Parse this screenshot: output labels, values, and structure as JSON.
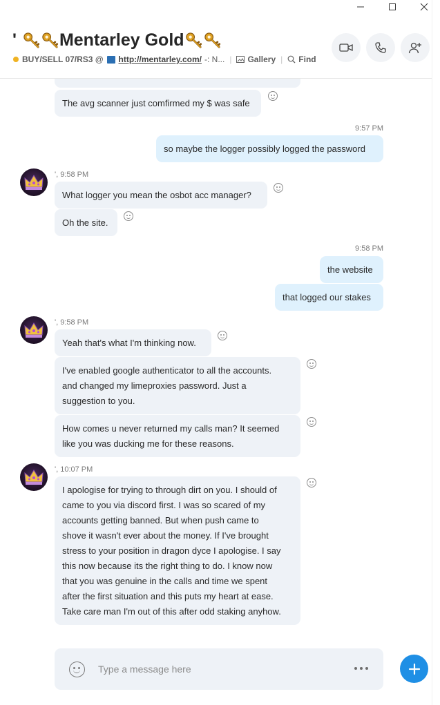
{
  "window": {
    "title_icons": [
      "minimize-icon",
      "maximize-icon",
      "close-icon"
    ]
  },
  "header": {
    "title_prefix": "'",
    "title_text": "Mentarley Gold",
    "topic_label": "BUY/SELL 07/RS3 @",
    "topic_link": "http://mentarley.com/",
    "topic_suffix": "-: N...",
    "gallery_label": "Gallery",
    "find_label": "Find"
  },
  "messages": {
    "m0_text": "The avg scanner just comfirmed my $ was safe",
    "t1": "9:57 PM",
    "m1_text": "so maybe the logger possibly logged the password",
    "t2": "', 9:58 PM",
    "m2_text": "What logger you mean the osbot acc manager?",
    "m3_text": "Oh the site.",
    "t3": "9:58 PM",
    "m4_text": "the website",
    "m5_text": "that logged our stakes",
    "t4": "', 9:58 PM",
    "m6_text": "Yeah that's what I'm thinking now.",
    "m7_line1": "I've enabled google authenticator to all the accounts.",
    "m7_line2": "and changed my limeproxies password. Just a",
    "m7_line3": "suggestion to you.",
    "m8_line1": "How comes u never returned my calls man? It seemed",
    "m8_line2": "like you was ducking me for these reasons.",
    "t5": "', 10:07 PM",
    "m9_lines": [
      "I apologise for trying to through dirt on you. I should of",
      "came to you via discord first. I was so scared of my",
      "accounts getting banned. But when push came to",
      "shove it wasn't ever about the money. If I've brought",
      "stress to your position in dragon dyce I apologise. I say",
      "this now because its the right thing to do. I know now",
      "that you was genuine in the calls and time we spent",
      "after the first situation and this puts my heart at ease.",
      "Take care man I'm out of this after odd staking anyhow."
    ]
  },
  "composer": {
    "placeholder": "Type a message here"
  },
  "colors": {
    "accent": "#1f8fe5",
    "bubble_in": "#eef2f7",
    "bubble_out": "#dff1fd"
  }
}
